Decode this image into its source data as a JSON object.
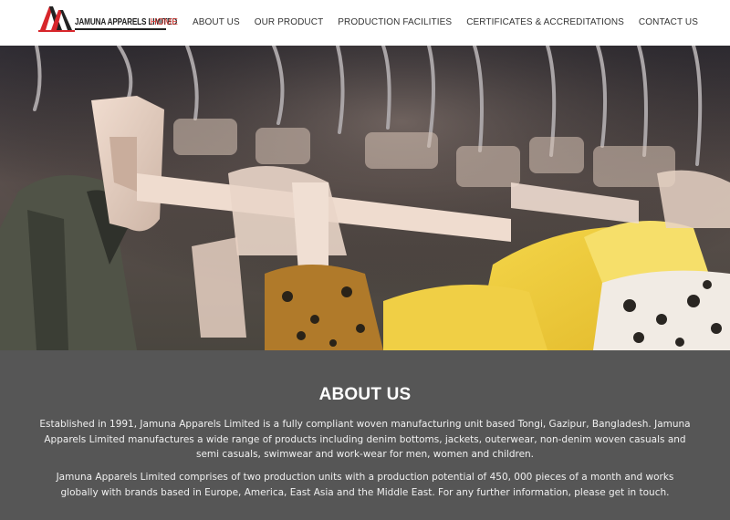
{
  "brand": {
    "name": "JAMUNA APPARELS LIMITED",
    "logo_icon": "jamuna-logo-icon",
    "colors": {
      "logo_red": "#d7262b",
      "logo_black": "#222222"
    }
  },
  "nav": {
    "items": [
      {
        "label": "HOME",
        "active": true
      },
      {
        "label": "ABOUT US",
        "active": false
      },
      {
        "label": "OUR PRODUCT",
        "active": false
      },
      {
        "label": "PRODUCTION FACILITIES",
        "active": false
      },
      {
        "label": "CERTIFICATES & ACCREDITATIONS",
        "active": false
      },
      {
        "label": "CONTACT US",
        "active": false
      }
    ],
    "colors": {
      "active": "#e0443e",
      "default": "#333333"
    }
  },
  "hero": {
    "image": "clothes-on-hangers-photo"
  },
  "about": {
    "title": "ABOUT US",
    "paragraphs": [
      "Established in 1991, Jamuna Apparels Limited is a fully compliant woven manufacturing unit based Tongi, Gazipur, Bangladesh. Jamuna Apparels Limited manufactures a wide range of products including denim bottoms, jackets, outerwear, non-denim woven casuals and semi casuals, swimwear and work-wear for men, women and children.",
      "Jamuna Apparels Limited comprises of two production units with a production potential of 450, 000 pieces of a month and works globally with brands based in Europe, America, East Asia and the Middle East. For any further information, please get in touch."
    ],
    "colors": {
      "background": "#565656",
      "text": "#f0f0f0"
    }
  }
}
